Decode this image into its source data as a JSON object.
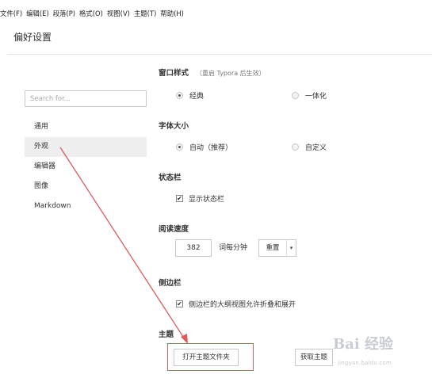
{
  "menubar": {
    "items": [
      "文件(F)",
      "编辑(E)",
      "段落(P)",
      "格式(O)",
      "视图(V)",
      "主题(T)",
      "帮助(H)"
    ]
  },
  "window": {
    "title": "偏好设置"
  },
  "sidebar": {
    "search_placeholder": "Search for...",
    "items": [
      {
        "label": "通用",
        "active": false
      },
      {
        "label": "外观",
        "active": true
      },
      {
        "label": "编辑器",
        "active": false
      },
      {
        "label": "图像",
        "active": false
      },
      {
        "label": "Markdown",
        "active": false
      }
    ]
  },
  "window_style": {
    "title": "窗口样式",
    "note": "（重启 Typora 后生效）",
    "option_classic": "经典",
    "option_unibody": "一体化",
    "selected": "经典"
  },
  "font_size": {
    "title": "字体大小",
    "option_auto": "自动（推荐）",
    "option_custom": "自定义",
    "selected": "自动（推荐）"
  },
  "status_bar": {
    "title": "状态栏",
    "show_label": "显示状态栏",
    "checked": true
  },
  "reading_speed": {
    "title": "阅读速度",
    "value": "382",
    "unit": "词每分钟",
    "reset_label": "重置",
    "dropdown_glyph": "▾"
  },
  "side_panel": {
    "title": "侧边栏",
    "outline_label": "侧边栏的大纲视图允许折叠和展开",
    "checked": true
  },
  "theme": {
    "title": "主题",
    "open_folder_label": "打开主题文件夹",
    "get_theme_label": "获取主题"
  },
  "watermark": {
    "text": "Bai 经验",
    "url": "jingyan.baidu.com"
  },
  "colors": {
    "annotation_red": "#dc5c5c",
    "active_nav_bg": "#eeeeee"
  },
  "checkmark_glyph": "✔"
}
